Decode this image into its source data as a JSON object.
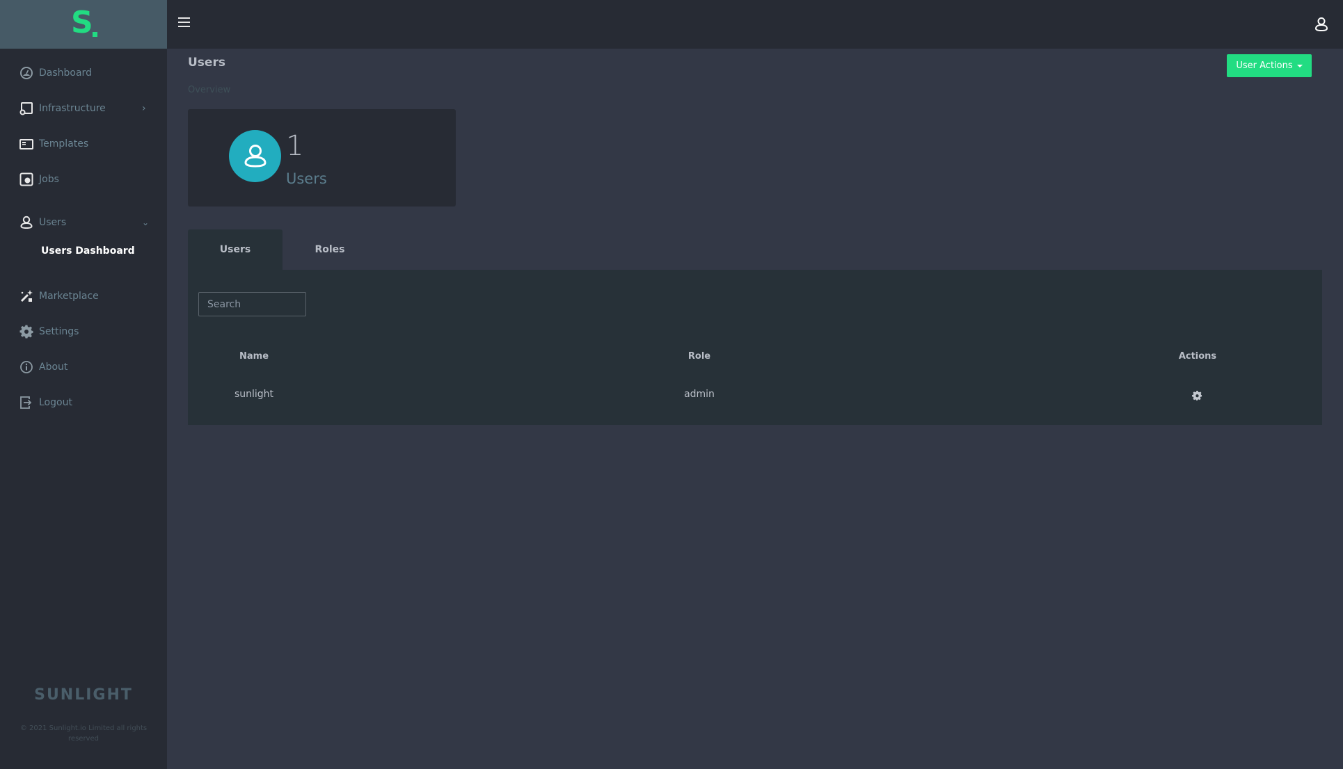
{
  "brand": {
    "logo_icon": "sunlight-s-logo",
    "footer_logo": "SUNLIGHT",
    "copyright": "© 2021 Sunlight.io Limited all rights reserved"
  },
  "sidebar": {
    "items": [
      {
        "label": "Dashboard",
        "icon": "dashboard-gauge-icon"
      },
      {
        "label": "Infrastructure",
        "icon": "infrastructure-icon",
        "chevron": "›"
      },
      {
        "label": "Templates",
        "icon": "templates-icon"
      },
      {
        "label": "Jobs",
        "icon": "jobs-icon"
      },
      {
        "label": "Users",
        "icon": "user-icon",
        "chevron": "⌄",
        "expanded": true
      },
      {
        "label": "Marketplace",
        "icon": "magic-wand-icon"
      },
      {
        "label": "Settings",
        "icon": "gear-icon"
      },
      {
        "label": "About",
        "icon": "info-icon"
      },
      {
        "label": "Logout",
        "icon": "logout-icon"
      }
    ],
    "sub_items": [
      {
        "label": "Users Dashboard",
        "active": true
      }
    ]
  },
  "header": {
    "menu_icon": "hamburger-icon",
    "user_icon": "user-icon"
  },
  "page": {
    "title": "Users",
    "subtitle": "Overview",
    "actions_button": "User Actions"
  },
  "stat": {
    "value": "1",
    "label": "Users"
  },
  "tabs": [
    {
      "label": "Users",
      "active": true
    },
    {
      "label": "Roles",
      "active": false
    }
  ],
  "search": {
    "placeholder": "Search",
    "value": ""
  },
  "table": {
    "columns": [
      "Name",
      "Role",
      "Actions"
    ],
    "rows": [
      {
        "name": "sunlight",
        "role": "admin",
        "action_icon": "gear-icon"
      }
    ]
  },
  "colors": {
    "accent": "#22dc82",
    "stat_avatar": "#22adbf",
    "sidebar_bg": "#272b34",
    "brand_bg": "#465a66",
    "content_bg": "#333846",
    "panel_bg": "#273138"
  }
}
